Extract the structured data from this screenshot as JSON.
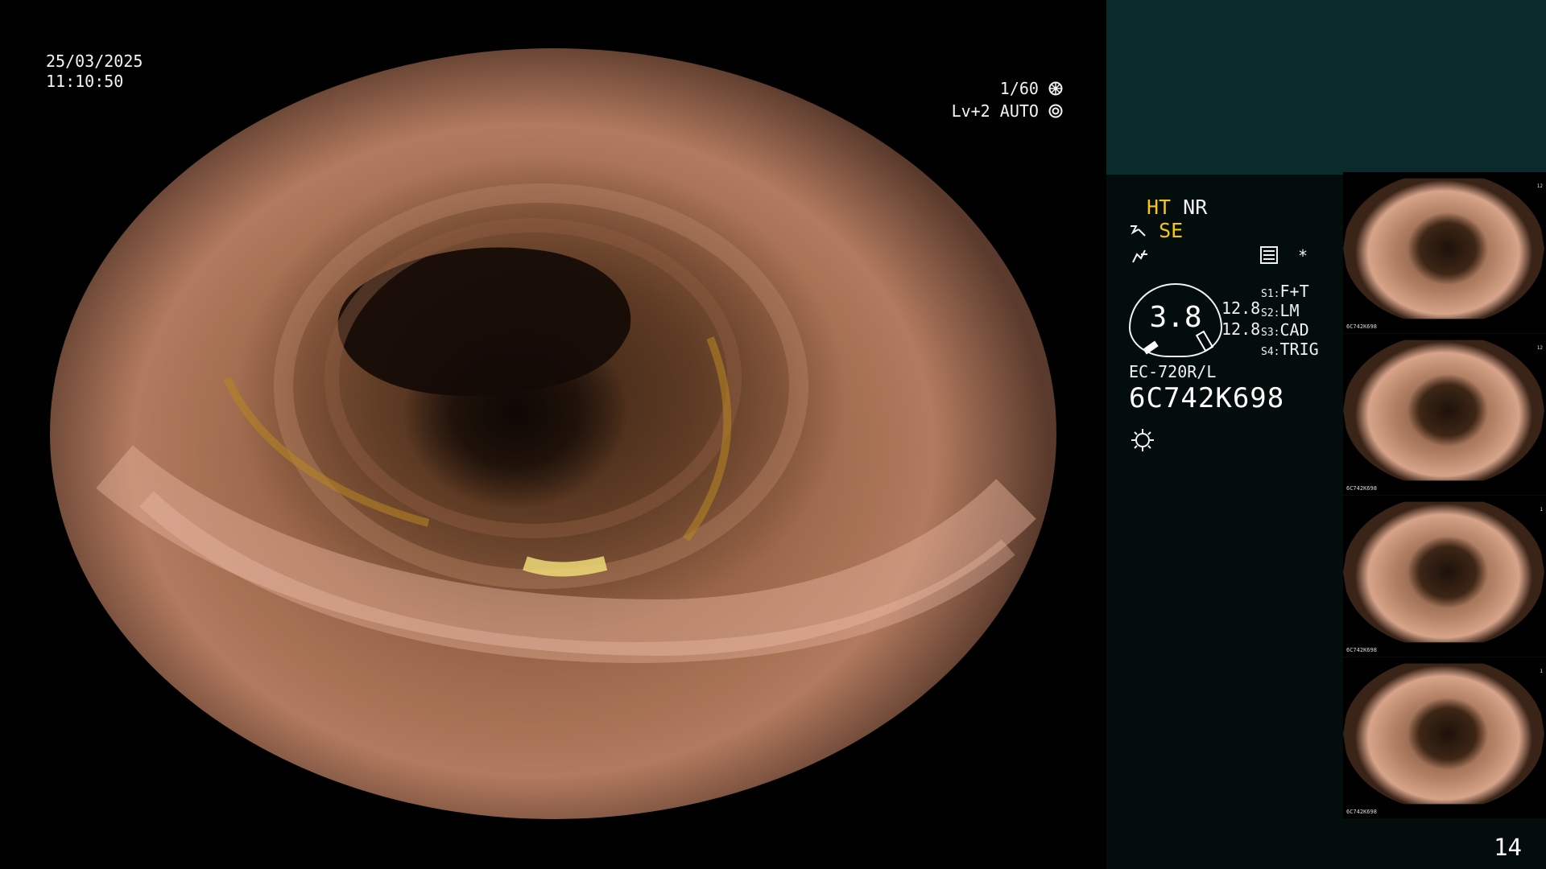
{
  "main_view": {
    "date": "25/03/2025",
    "time": "11:10:50",
    "shutter": "1/60",
    "level": "Lv+2",
    "mode": "AUTO"
  },
  "side_panel": {
    "mode_line1_a": "HT",
    "mode_line1_b": "NR",
    "mode_line2": "SE",
    "gauge_value": "3.8",
    "values": [
      "12.8",
      "12.8"
    ],
    "switches": [
      {
        "key": "S1:",
        "value": "F+T"
      },
      {
        "key": "S2:",
        "value": "LM"
      },
      {
        "key": "S3:",
        "value": "CAD"
      },
      {
        "key": "S4:",
        "value": "TRIG"
      }
    ],
    "asterisk": "*",
    "scope_model": "EC-720R/L",
    "serial": "6C742K698",
    "page_number": "14",
    "colors": {
      "highlight": "#f7c514",
      "panel": "#020d0c",
      "teal": "#0b2a2b"
    }
  },
  "thumbnails": [
    {
      "serial": "6C742K698",
      "right_number": "12"
    },
    {
      "serial": "6C742K698",
      "right_number": "12"
    },
    {
      "serial": "6C742K698",
      "right_number": "1"
    },
    {
      "serial": "6C742K698",
      "right_number": "1"
    }
  ],
  "icons": [
    "aperture-icon",
    "auto-iris-icon",
    "light-source-icon",
    "settings-icon"
  ]
}
